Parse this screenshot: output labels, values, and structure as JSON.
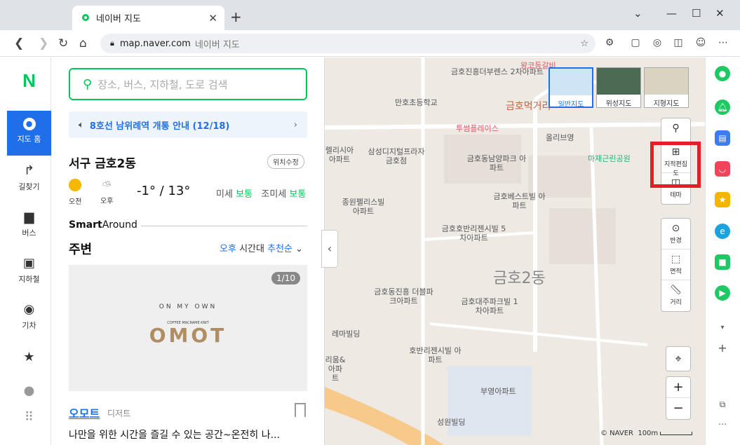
{
  "browser": {
    "tab_title": "네이버 지도",
    "url_host": "map.naver.com",
    "url_title": "네이버 지도"
  },
  "leftnav": {
    "logo": "N",
    "items": [
      {
        "label": "지도 홈",
        "icon": "map-pin-icon"
      },
      {
        "label": "길찾기",
        "icon": "route-arrow-icon"
      },
      {
        "label": "버스",
        "icon": "bus-icon"
      },
      {
        "label": "지하철",
        "icon": "subway-icon"
      },
      {
        "label": "기차",
        "icon": "train-icon"
      }
    ]
  },
  "panel": {
    "search_placeholder": "장소, 버스, 지하철, 도로 검색",
    "notice": "8호선 남위례역 개통 안내 (12/18)",
    "location": "서구 금호2동",
    "fix_location": "위치수정",
    "weather": {
      "am_label": "오전",
      "pm_label": "오후",
      "low": "-1°",
      "high": "13°",
      "fine_dust_label": "미세",
      "fine_dust_value": "보통",
      "ultra_dust_label": "조미세",
      "ultra_dust_value": "보통"
    },
    "smart_around": {
      "bold": "Smart",
      "rest": "Around"
    },
    "nearby_title": "주변",
    "sort": {
      "time": "오후",
      "mid": "시간대",
      "order": "추천순"
    },
    "card_counter": "1/10",
    "brand_text": "OMOT",
    "brand_sub": "COFFEE MACRAME·KNIT",
    "brand_arc": "ON MY OWN",
    "place_name": "오모트",
    "place_category": "디저트",
    "place_desc": "나만을 위한 시간을 즐길 수 있는 공간~온전히 나..."
  },
  "map": {
    "types": [
      "일반지도",
      "위성지도",
      "지형지도"
    ],
    "tools": [
      "테마",
      "반경",
      "면적",
      "거리"
    ],
    "cadastral_label": "지적편집도",
    "district": "금호2동",
    "labels": [
      "금호진흥더부렌스 2차아파트",
      "만호초등학교",
      "금호먹거리",
      "투썸플레이스",
      "올리브영",
      "삼성디지털프라자 금호점",
      "금호동남양파크 아파트",
      "마재근린공원",
      "렐리시아 아파트",
      "종원펠리스빌 아파트",
      "금호베스트빌 아파트",
      "금호호반리젠시빌 5차아파트",
      "금호동진흥 더블파크아파트",
      "금호대주파크빌 1차아파트",
      "레마빌딩",
      "호반리젠시빌 아파트",
      "리움& 아파트",
      "부영아파트",
      "성원빌딩",
      "왕코등갈비"
    ],
    "copyright": "© NAVER",
    "scale": "100m"
  }
}
